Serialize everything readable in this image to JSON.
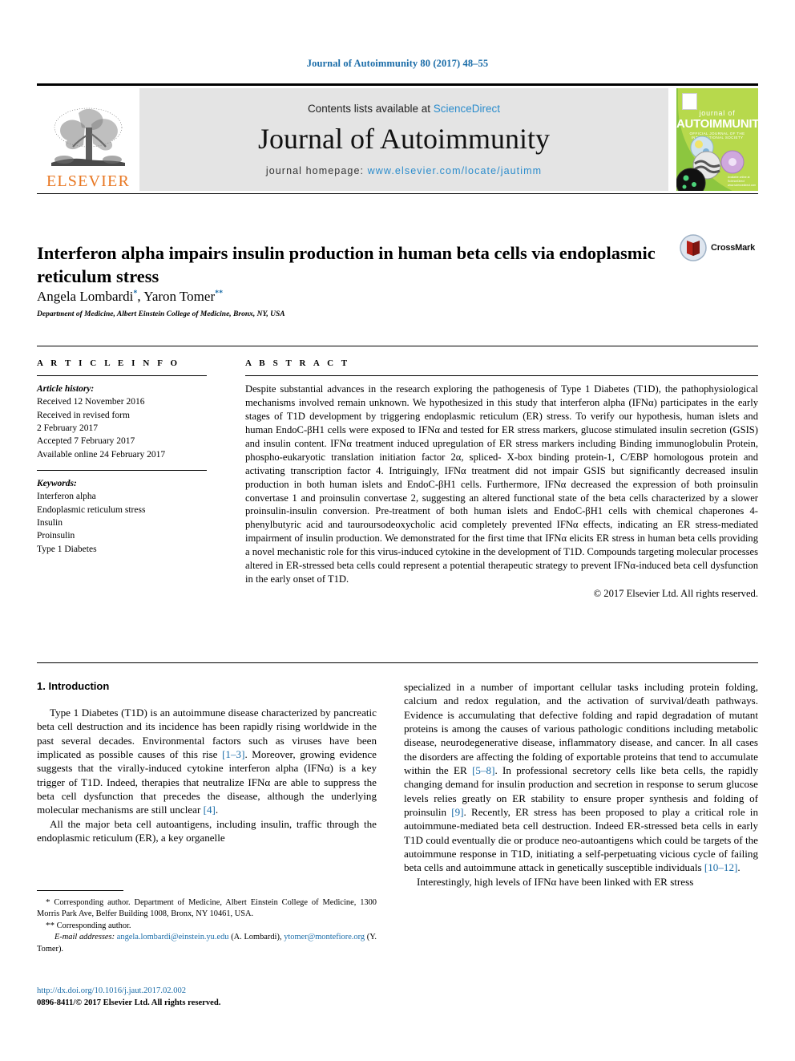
{
  "running_head": "Journal of Autoimmunity 80 (2017) 48–55",
  "masthead": {
    "publisher_logo_text": "ELSEVIER",
    "contents_prefix": "Contents lists available at ",
    "contents_link": "ScienceDirect",
    "journal_name": "Journal of Autoimmunity",
    "homepage_prefix": "journal homepage: ",
    "homepage_url": "www.elsevier.com/locate/jautimm",
    "cover": {
      "journal_of": "journal of",
      "title": "AUTOIMMUNITY",
      "subtitle": "OFFICIAL JOURNAL OF THE INTERNATIONAL SOCIETY"
    }
  },
  "article": {
    "title": "Interferon alpha impairs insulin production in human beta cells via endoplasmic reticulum stress",
    "authors_html": "Angela Lombardi<sup>*</sup>, Yaron Tomer<sup>**</sup>",
    "affiliation": "Department of Medicine, Albert Einstein College of Medicine, Bronx, NY, USA",
    "crossmark_label": "CrossMark"
  },
  "article_info": {
    "heading": "A R T I C L E   I N F O",
    "history_title": "Article history:",
    "history": [
      "Received 12 November 2016",
      "Received in revised form",
      "2 February 2017",
      "Accepted 7 February 2017",
      "Available online 24 February 2017"
    ],
    "keywords_title": "Keywords:",
    "keywords": [
      "Interferon alpha",
      "Endoplasmic reticulum stress",
      "Insulin",
      "Proinsulin",
      "Type 1 Diabetes"
    ]
  },
  "abstract": {
    "heading": "A B S T R A C T",
    "text": "Despite substantial advances in the research exploring the pathogenesis of Type 1 Diabetes (T1D), the pathophysiological mechanisms involved remain unknown. We hypothesized in this study that interferon alpha (IFNα) participates in the early stages of T1D development by triggering endoplasmic reticulum (ER) stress. To verify our hypothesis, human islets and human EndoC-βH1 cells were exposed to IFNα and tested for ER stress markers, glucose stimulated insulin secretion (GSIS) and insulin content. IFNα treatment induced upregulation of ER stress markers including Binding immunoglobulin Protein, phospho-eukaryotic translation initiation factor 2α, spliced- X-box binding protein-1, C/EBP homologous protein and activating transcription factor 4. Intriguingly, IFNα treatment did not impair GSIS but significantly decreased insulin production in both human islets and EndoC-βH1 cells. Furthermore, IFNα decreased the expression of both proinsulin convertase 1 and proinsulin convertase 2, suggesting an altered functional state of the beta cells characterized by a slower proinsulin-insulin conversion. Pre-treatment of both human islets and EndoC-βH1 cells with chemical chaperones 4-phenylbutyric acid and tauroursodeoxycholic acid completely prevented IFNα effects, indicating an ER stress-mediated impairment of insulin production. We demonstrated for the first time that IFNα elicits ER stress in human beta cells providing a novel mechanistic role for this virus-induced cytokine in the development of T1D. Compounds targeting molecular processes altered in ER-stressed beta cells could represent a potential therapeutic strategy to prevent IFNα-induced beta cell dysfunction in the early onset of T1D.",
    "copyright": "© 2017 Elsevier Ltd. All rights reserved."
  },
  "body": {
    "section_heading": "1. Introduction",
    "left_paragraphs_html": [
      "Type 1 Diabetes (T1D) is an autoimmune disease characterized by pancreatic beta cell destruction and its incidence has been rapidly rising worldwide in the past several decades. Environmental factors such as viruses have been implicated as possible causes of this rise <span class=\"ref\">[1&#8211;3]</span>. Moreover, growing evidence suggests that the virally-induced cytokine interferon alpha (IFN&#945;) is a key trigger of T1D. Indeed, therapies that neutralize IFN&#945; are able to suppress the beta cell dysfunction that precedes the disease, although the underlying molecular mechanisms are still unclear <span class=\"ref\">[4]</span>.",
      "All the major beta cell autoantigens, including insulin, traffic through the endoplasmic reticulum (ER), a key organelle"
    ],
    "right_paragraphs_html": [
      "specialized in a number of important cellular tasks including protein folding, calcium and redox regulation, and the activation of survival/death pathways. Evidence is accumulating that defective folding and rapid degradation of mutant proteins is among the causes of various pathologic conditions including metabolic disease, neurodegenerative disease, inflammatory disease, and cancer. In all cases the disorders are affecting the folding of exportable proteins that tend to accumulate within the ER <span class=\"ref\">[5&#8211;8]</span>. In professional secretory cells like beta cells, the rapidly changing demand for insulin production and secretion in response to serum glucose levels relies greatly on ER stability to ensure proper synthesis and folding of proinsulin <span class=\"ref\">[9]</span>. Recently, ER stress has been proposed to play a critical role in autoimmune-mediated beta cell destruction. Indeed ER-stressed beta cells in early T1D could eventually die or produce neo-autoantigens which could be targets of the autoimmune response in T1D, initiating a self-perpetuating vicious cycle of failing beta cells and autoimmune attack in genetically susceptible individuals <span class=\"ref\">[10&#8211;12]</span>.",
      "Interestingly, high levels of IFN&#945; have been linked with ER stress"
    ]
  },
  "footnotes": {
    "line1_html": "<span style=\"font-size:11px\">*</span> Corresponding author. Department of Medicine, Albert Einstein College of Medicine, 1300 Morris Park Ave, Belfer Building 1008, Bronx, NY 10461, USA.",
    "line2_html": "<span style=\"font-size:11px\">**</span> Corresponding author.",
    "line3_html": "<em>E-mail addresses:</em> <span class=\"link\">angela.lombardi@einstein.yu.edu</span> (A. Lombardi), <span class=\"link\">ytomer@montefiore.org</span> (Y. Tomer)."
  },
  "doi_block": {
    "doi_url": "http://dx.doi.org/10.1016/j.jaut.2017.02.002",
    "issn_line": "0896-8411/© 2017 Elsevier Ltd. All rights reserved."
  }
}
